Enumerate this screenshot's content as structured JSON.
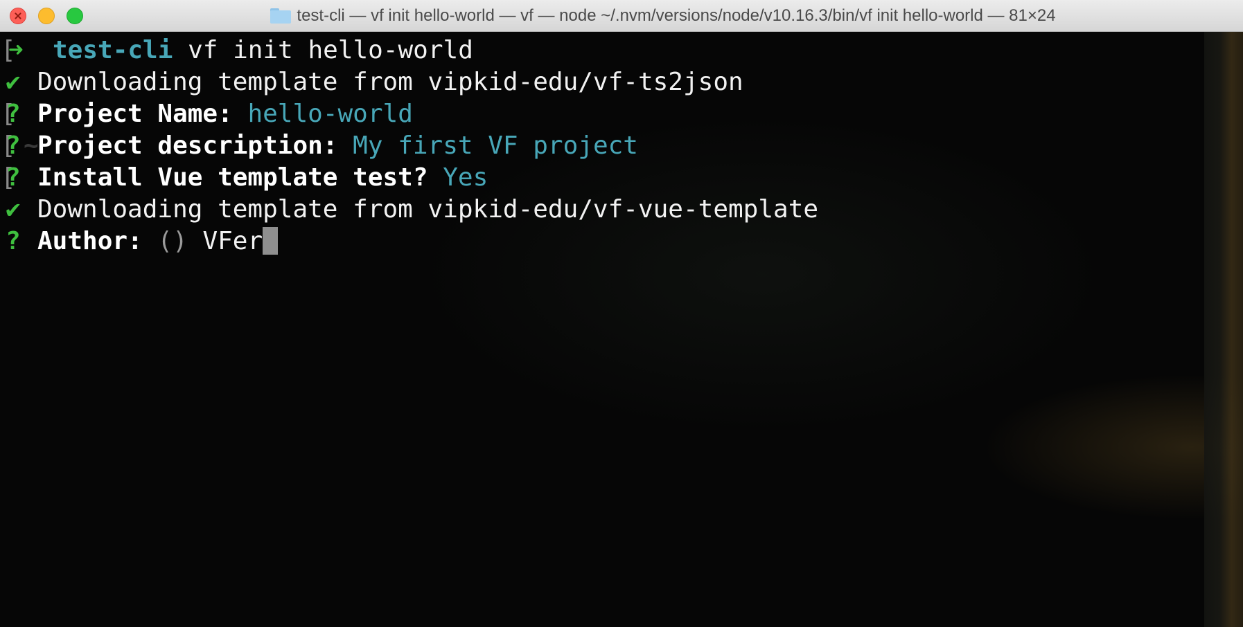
{
  "window": {
    "title": "test-cli — vf init hello-world — vf — node ~/.nvm/versions/node/v10.16.3/bin/vf init hello-world — 81×24",
    "folder_icon": "folder-icon"
  },
  "terminal": {
    "prompt": {
      "arrow": "➜",
      "tilde": "~",
      "directory": "test-cli",
      "command": "vf init hello-world"
    },
    "lines": [
      {
        "marker": "✔",
        "text": "Downloading template from vipkid-edu/vf-ts2json"
      },
      {
        "marker": "?",
        "label": "Project Name:",
        "answer": "hello-world"
      },
      {
        "marker": "?",
        "label": "Project description:",
        "answer": "My first VF project"
      },
      {
        "marker": "?",
        "label": "Install Vue template test?",
        "answer": "Yes"
      },
      {
        "marker": "✔",
        "text": "Downloading template from vipkid-edu/vf-vue-template"
      },
      {
        "marker": "?",
        "label": "Author:",
        "default_hint": "()",
        "input": "VFer"
      }
    ]
  },
  "colors": {
    "green": "#3fbf3f",
    "cyan": "#48a7b8",
    "text": "#f2f2f2",
    "cursor": "#8f8f8f"
  }
}
